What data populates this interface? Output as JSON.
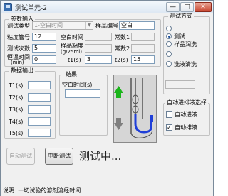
{
  "window": {
    "title": "测试单元-2",
    "minimize": "—",
    "maximize": "□",
    "close": "✕"
  },
  "params": {
    "group_label": "参数输入",
    "test_type_label": "测试类型",
    "test_type_value": "1-空白时间",
    "sample_no_label": "样品编号",
    "sample_no_value": "空白",
    "visc_tube_label": "粘度管号",
    "visc_tube_value": "12",
    "blank_time_label": "空白时间",
    "blank_time_value": "",
    "const1_label": "常数1",
    "const1_value": "",
    "test_count_label": "测试次数",
    "test_count_value": "5",
    "sample_density_label": "样品粘度",
    "sample_density_unit": "(g/25ml)",
    "sample_density_value": "",
    "const2_label": "常数2",
    "const2_value": "",
    "temp_time_label": "恒温时间",
    "temp_time_unit": "(min)",
    "temp_time_value": "0",
    "t1_label": "t1(s)",
    "t1_value": "3",
    "t2_label": "t2(s)",
    "t2_value": "15"
  },
  "test_mode": {
    "group_label": "测试方式",
    "options": [
      "",
      "测试",
      "样品润洗",
      "",
      "洗液清洗"
    ],
    "selected_index": 1,
    "extra_value": ""
  },
  "data_output": {
    "group_label": "数据输出",
    "rows": [
      {
        "label": "T1(s)",
        "value": ""
      },
      {
        "label": "T2(s)",
        "value": ""
      },
      {
        "label": "T3(s)",
        "value": ""
      },
      {
        "label": "T4(s)",
        "value": ""
      },
      {
        "label": "T5(s)",
        "value": ""
      }
    ]
  },
  "result": {
    "group_label": "结果",
    "blank_time_label": "空白时间(s)",
    "blank_time_value": ""
  },
  "auto": {
    "group_label": "自动进排液选择",
    "auto_in_label": "自动进液",
    "auto_in_checked": false,
    "auto_out_label": "自动排液",
    "auto_out_checked": true,
    "check_mark": "✓"
  },
  "buttons": {
    "auto_test": "自动测试",
    "stop_test": "中断测试"
  },
  "status": {
    "big_text": "测试中...",
    "bar_text": "说明: 一切试验的溶剂流经时间"
  },
  "colors": {
    "arrow_up": "#1bb51b",
    "arrow_down": "#7f7f7f",
    "liquid": "#1f3fd8"
  }
}
